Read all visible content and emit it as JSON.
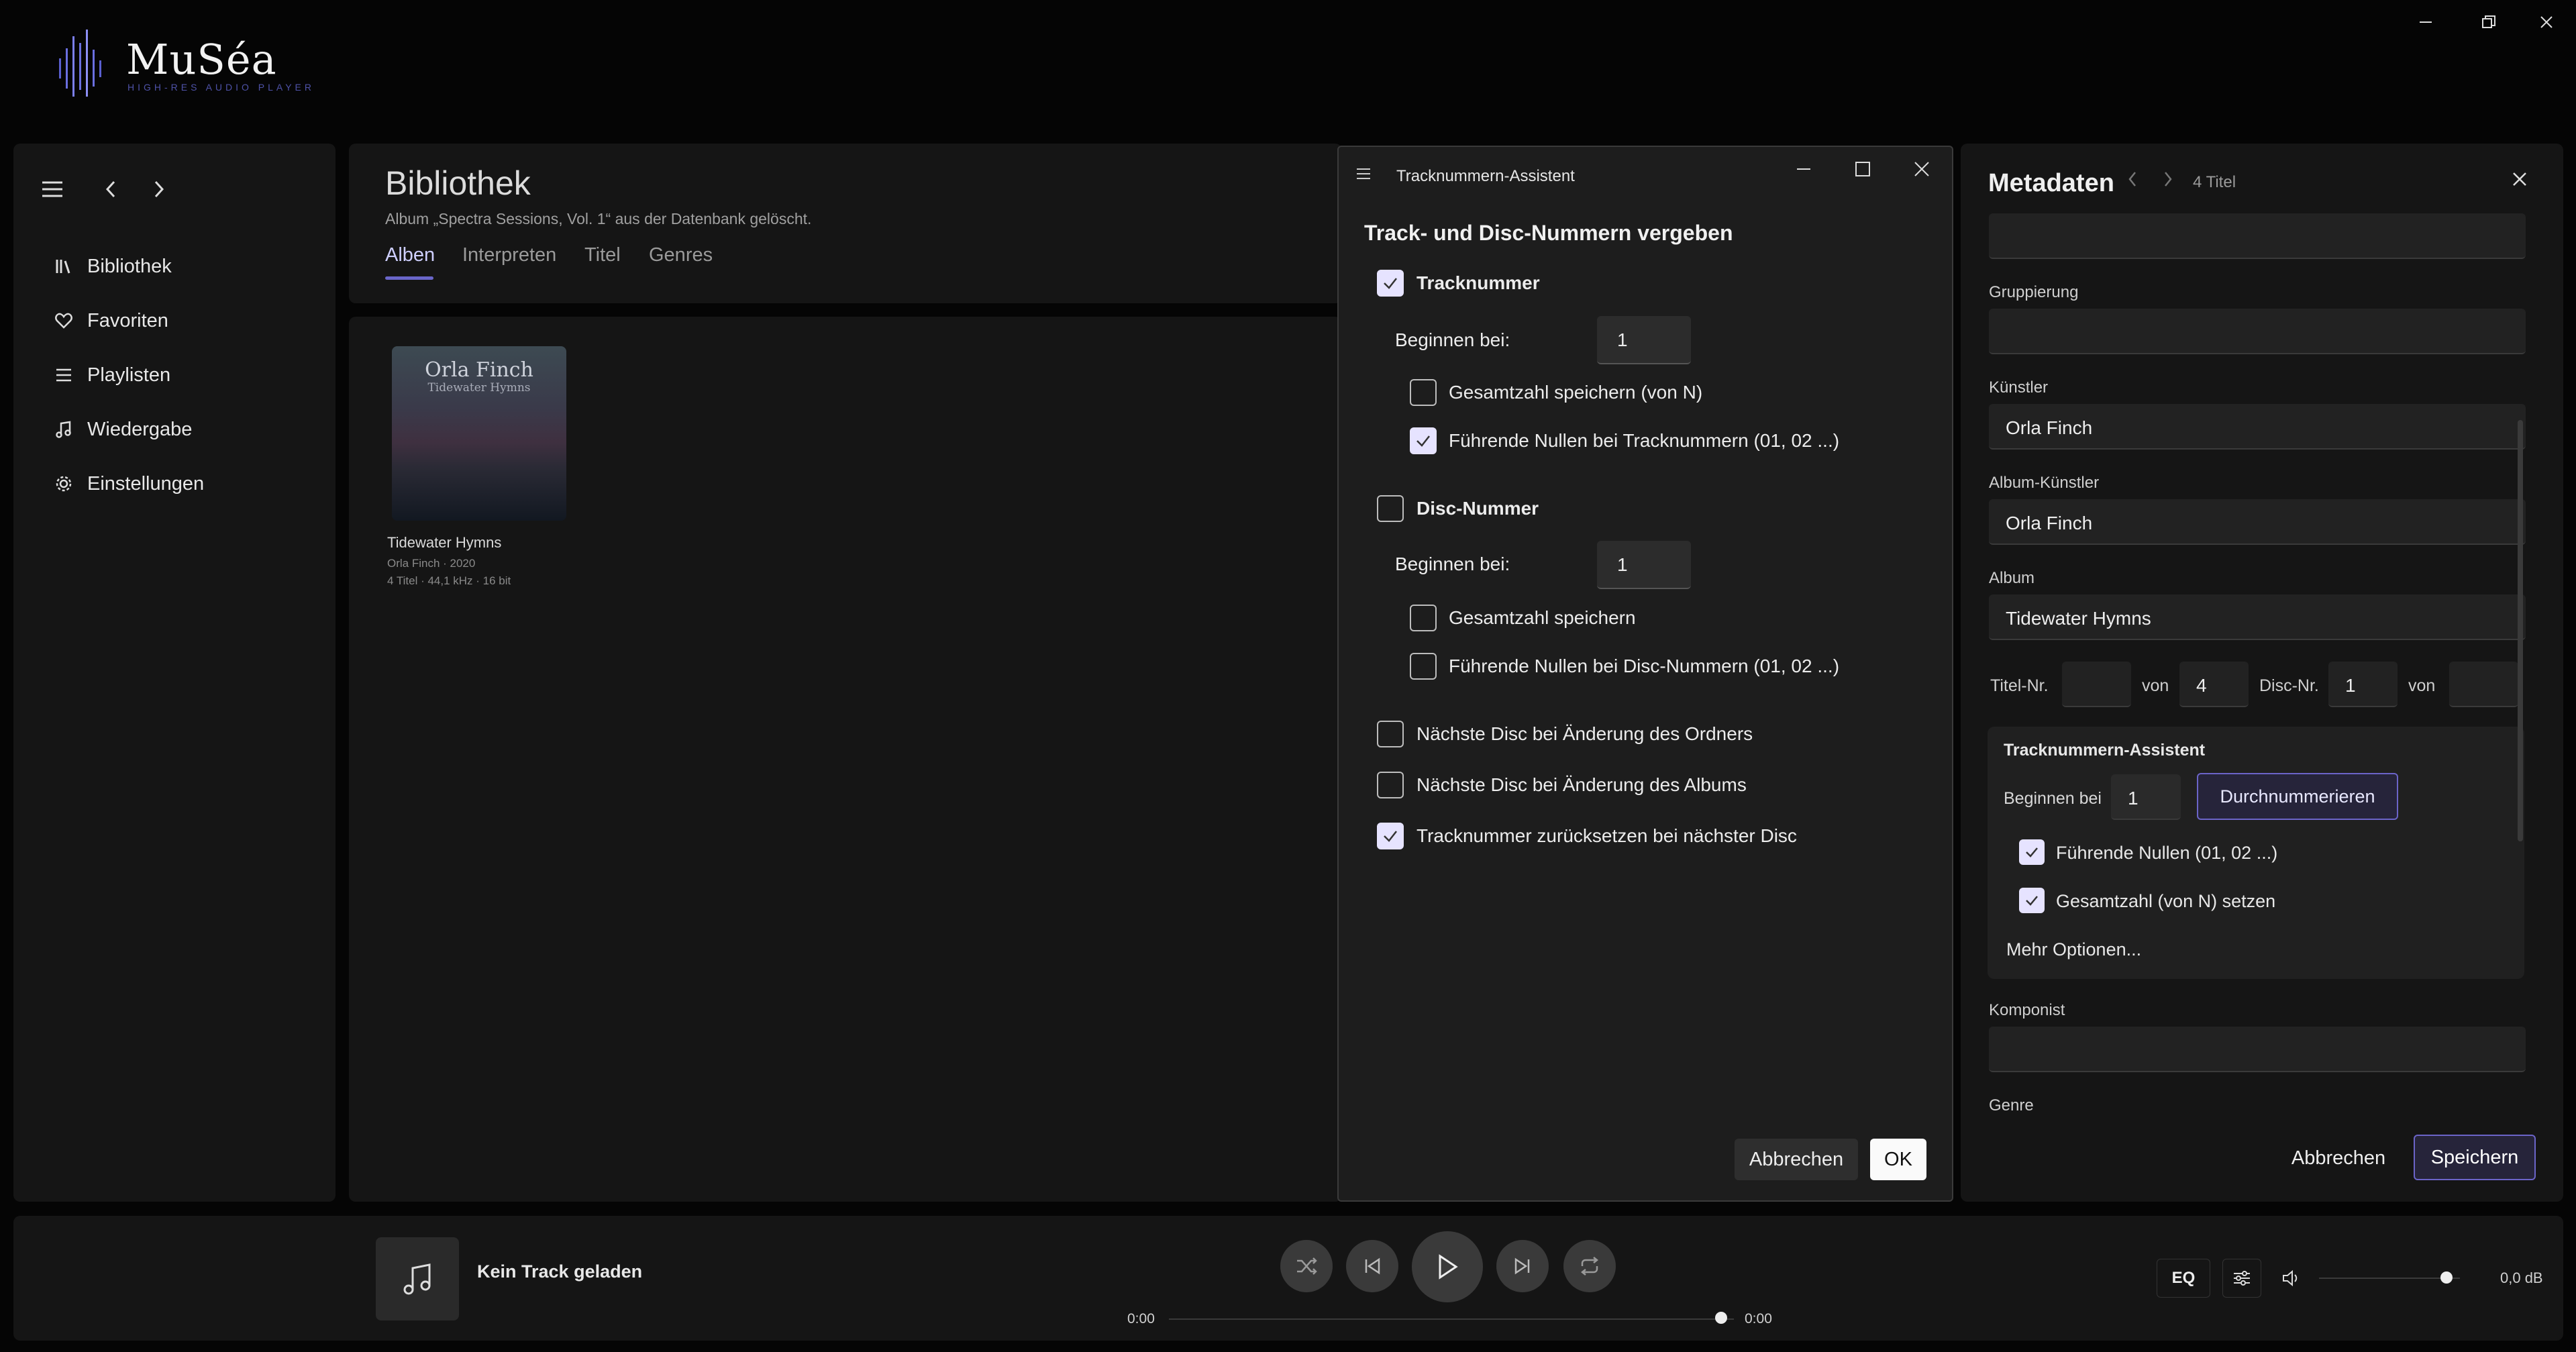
{
  "app": {
    "name": "MuSéa",
    "tagline": "HIGH-RES AUDIO PLAYER"
  },
  "window_controls": [
    "minimize-icon",
    "restore-icon",
    "close-icon"
  ],
  "sidebar": {
    "items": [
      {
        "label": "Bibliothek",
        "icon": "library-icon"
      },
      {
        "label": "Favoriten",
        "icon": "heart-icon"
      },
      {
        "label": "Playlisten",
        "icon": "list-icon"
      },
      {
        "label": "Wiedergabe",
        "icon": "music-note-icon"
      },
      {
        "label": "Einstellungen",
        "icon": "gear-icon"
      }
    ]
  },
  "library": {
    "title": "Bibliothek",
    "status": "Album „Spectra Sessions, Vol. 1“ aus der Datenbank gelöscht.",
    "tabs": [
      "Alben",
      "Interpreten",
      "Titel",
      "Genres"
    ],
    "active_tab": "Alben",
    "album": {
      "cover_artist": "Orla Finch",
      "cover_title": "Tidewater Hymns",
      "name": "Tidewater Hymns",
      "meta1": "Orla Finch · 2020",
      "meta2": "4 Titel · 44,1 kHz · 16 bit"
    }
  },
  "dialog": {
    "title": "Tracknummern-Assistent",
    "heading": "Track- und Disc-Nummern vergeben",
    "track": {
      "label": "Tracknummer",
      "checked": true,
      "start_label": "Beginnen bei:",
      "start_value": "1",
      "total_label": "Gesamtzahl speichern (von N)",
      "total_checked": false,
      "zeros_label": "Führende Nullen bei Tracknummern (01, 02 ...)",
      "zeros_checked": true
    },
    "disc": {
      "label": "Disc-Nummer",
      "checked": false,
      "start_label": "Beginnen bei:",
      "start_value": "1",
      "total_label": "Gesamtzahl speichern",
      "total_checked": false,
      "zeros_label": "Führende Nullen bei Disc-Nummern (01, 02 ...)",
      "zeros_checked": false
    },
    "options": [
      {
        "label": "Nächste Disc bei Änderung des Ordners",
        "checked": false
      },
      {
        "label": "Nächste Disc bei Änderung des Albums",
        "checked": false
      },
      {
        "label": "Tracknummer zurücksetzen bei nächster Disc",
        "checked": true
      }
    ],
    "cancel": "Abbrechen",
    "ok": "OK"
  },
  "metadata": {
    "title": "Metadaten",
    "count": "4 Titel",
    "fields": {
      "grouping_label": "Gruppierung",
      "grouping_value": "",
      "artist_label": "Künstler",
      "artist_value": "Orla Finch",
      "album_artist_label": "Album-Künstler",
      "album_artist_value": "Orla Finch",
      "album_label": "Album",
      "album_value": "Tidewater Hymns",
      "title_nr_label": "Titel-Nr.",
      "title_nr_value": "",
      "von_label": "von",
      "title_total": "4",
      "disc_nr_label": "Disc-Nr.",
      "disc_nr_value": "1",
      "von2_label": "von",
      "disc_total": "",
      "composer_label": "Komponist",
      "composer_value": "",
      "genre_label": "Genre"
    },
    "assistant": {
      "title": "Tracknummern-Assistent",
      "start_label": "Beginnen bei",
      "start_value": "1",
      "number_button": "Durchnummerieren",
      "zeros_label": "Führende Nullen (01, 02 ...)",
      "zeros_checked": true,
      "total_label": "Gesamtzahl (von N) setzen",
      "total_checked": true,
      "more": "Mehr Optionen..."
    },
    "cancel": "Abbrechen",
    "save": "Speichern"
  },
  "player": {
    "track": "Kein Track geladen",
    "time_start": "0:00",
    "time_end": "0:00",
    "eq": "EQ",
    "volume_db": "0,0 dB",
    "volume_level": 1.0,
    "progress": 1.0
  }
}
